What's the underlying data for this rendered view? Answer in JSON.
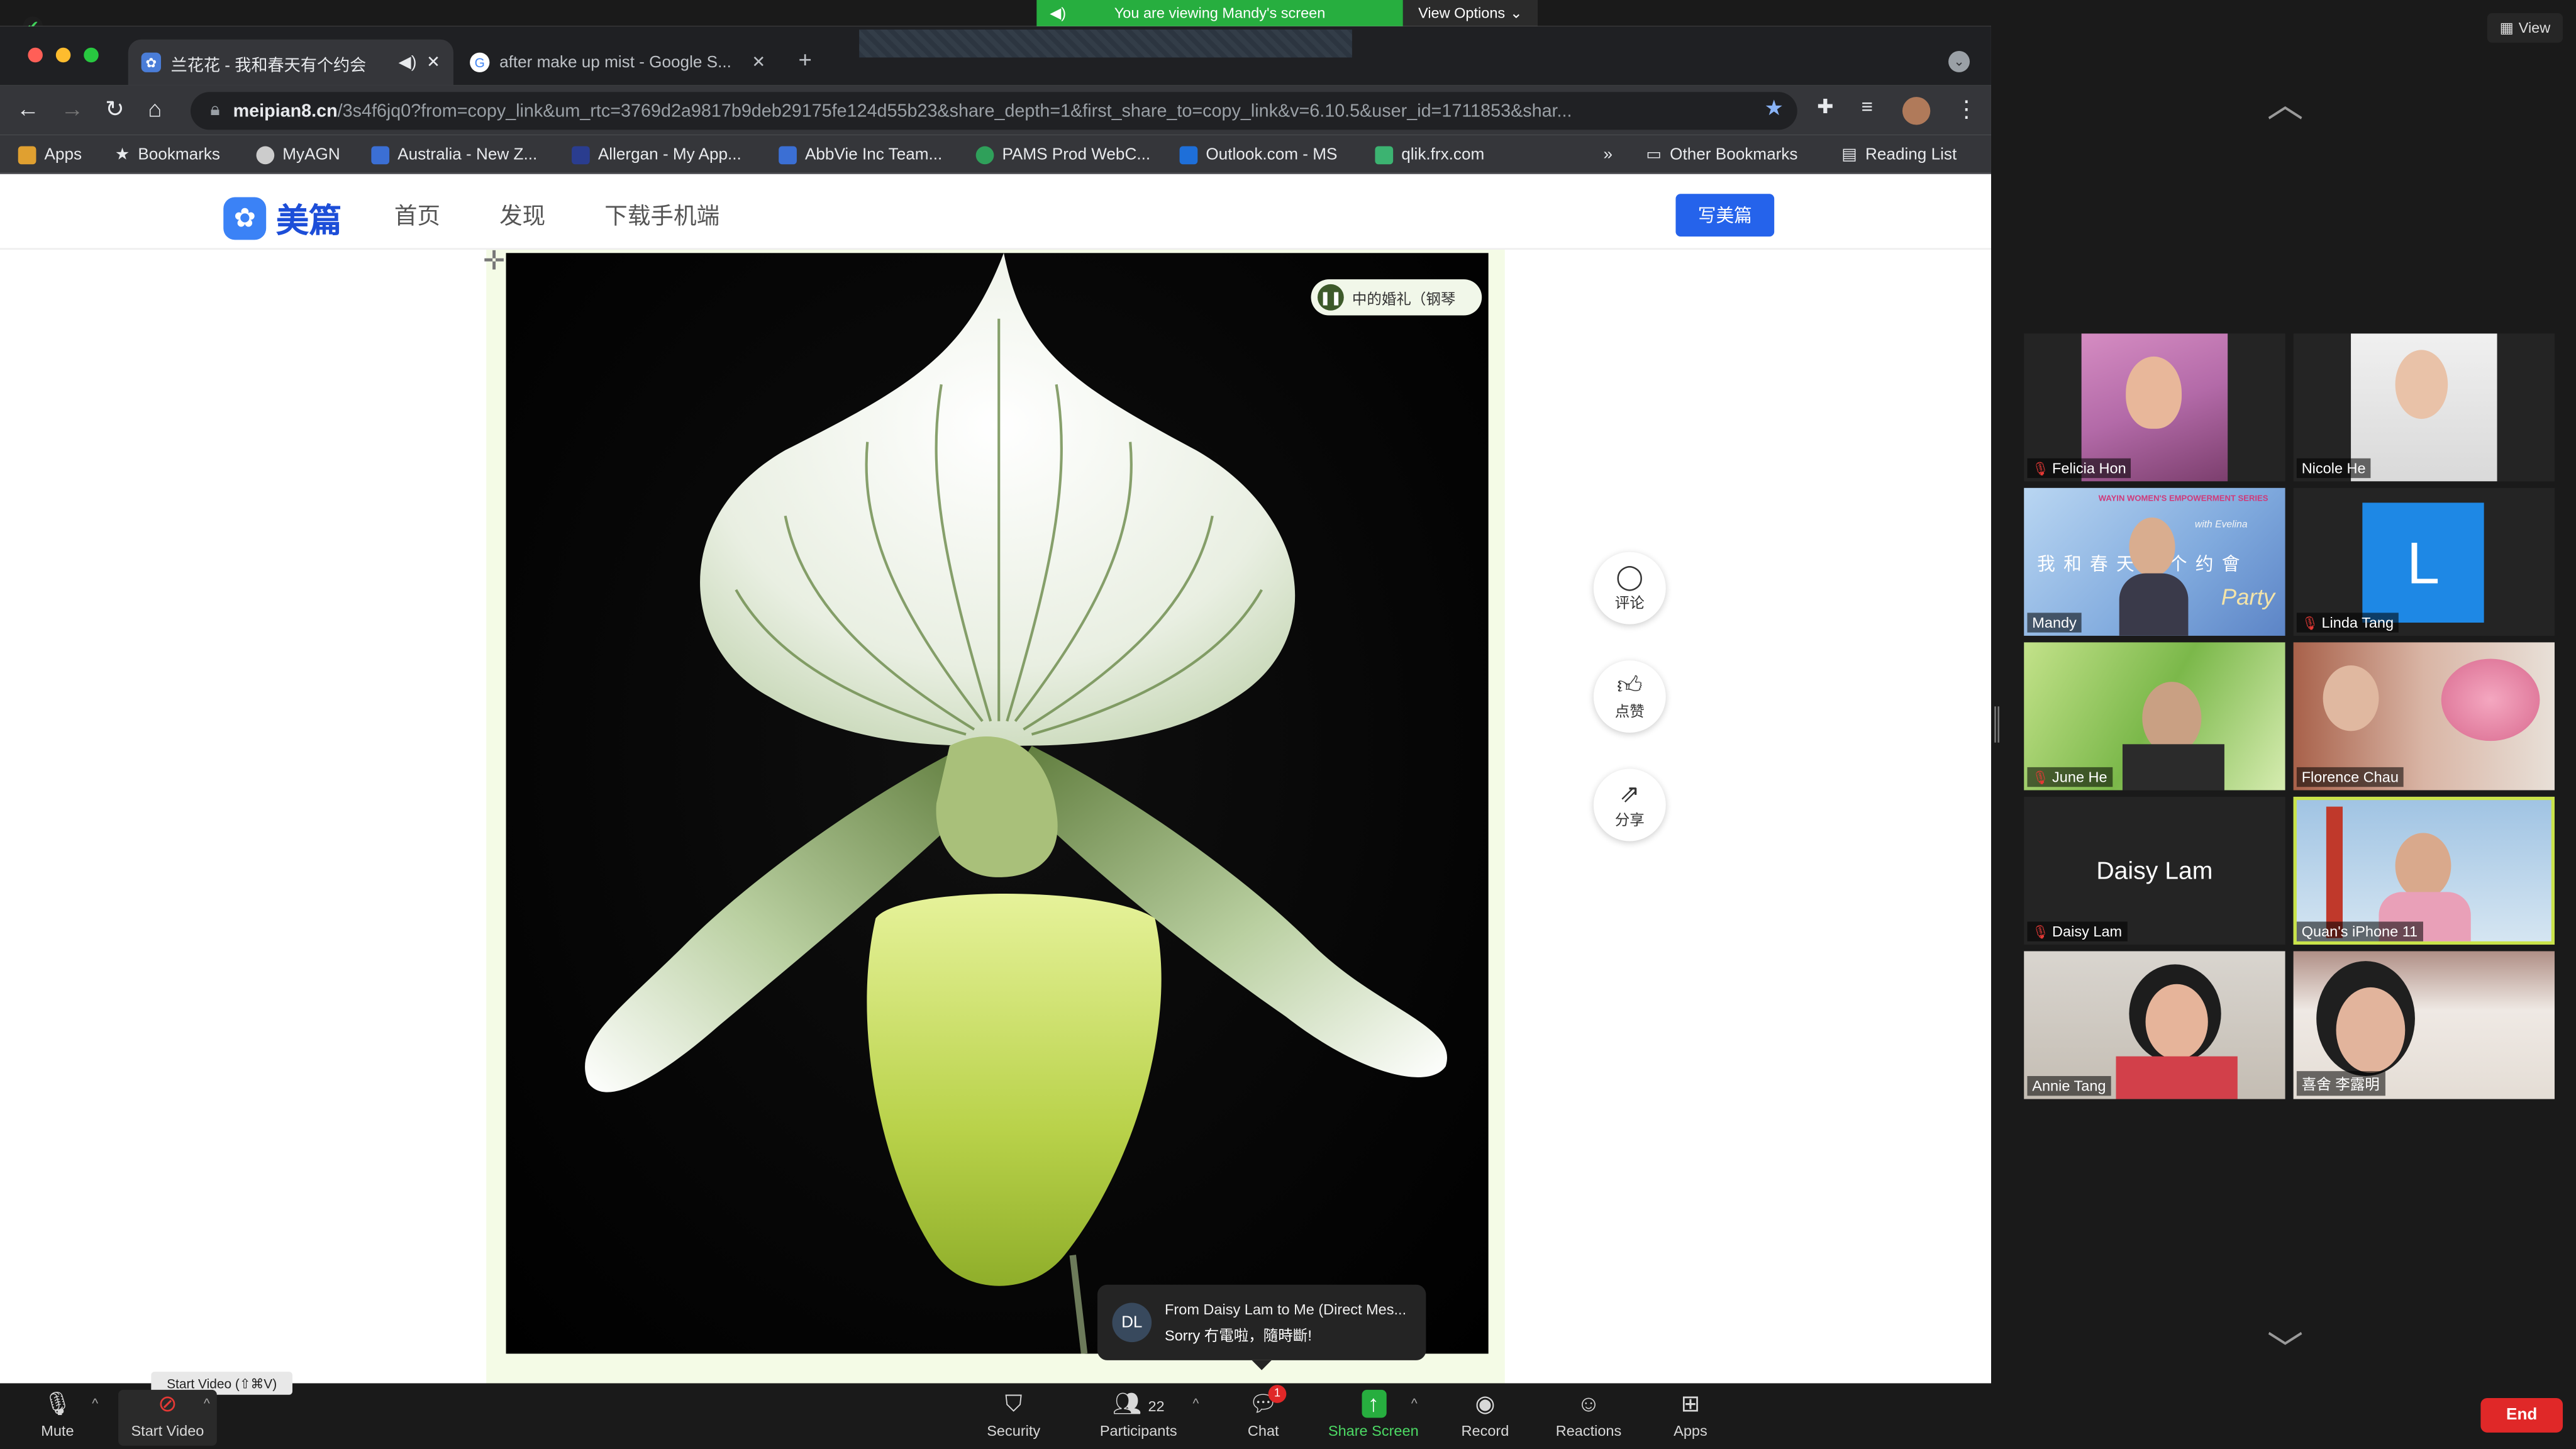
{
  "zoom": {
    "banner_text": "You are viewing Mandy's screen",
    "view_options_label": "View Options",
    "view_button_label": "View",
    "tooltip": "Start Video (⇧⌘V)",
    "end_label": "End",
    "chat_badge": "1",
    "participants_count": "22",
    "controls": [
      {
        "label": "Mute"
      },
      {
        "label": "Start Video"
      },
      {
        "label": "Security"
      },
      {
        "label": "Participants"
      },
      {
        "label": "Chat"
      },
      {
        "label": "Share Screen"
      },
      {
        "label": "Record"
      },
      {
        "label": "Reactions"
      },
      {
        "label": "Apps"
      }
    ],
    "chat_notification": {
      "avatar": "DL",
      "from": "From Daisy Lam to Me (Direct Mes...",
      "message": "Sorry 冇電啦，隨時斷!"
    },
    "gallery": [
      {
        "name": "Felicia Hon"
      },
      {
        "name": "Nicole He"
      },
      {
        "name": "Mandy",
        "banner_title": "WAYIN WOMEN'S EMPOWERMENT SERIES",
        "banner_script": "with Evelina",
        "banner_cn": "我 和 春 天 有 个 约 會",
        "banner_party": "Party"
      },
      {
        "name": "Linda Tang",
        "initial": "L"
      },
      {
        "name": "June He"
      },
      {
        "name": "Florence Chau"
      },
      {
        "name": "Daisy Lam",
        "display": "Daisy Lam"
      },
      {
        "name": "Quan's iPhone  11"
      },
      {
        "name": "Annie Tang"
      },
      {
        "name": "喜舍 李露明"
      }
    ]
  },
  "browser": {
    "tabs": [
      {
        "title": "兰花花 - 我和春天有个约会"
      },
      {
        "title": "after make up mist - Google S..."
      }
    ],
    "url_domain": "meipian8.cn",
    "url_path": "/3s4f6jq0?from=copy_link&um_rtc=3769d2a9817b9deb29175fe124d55b23&share_depth=1&first_share_to=copy_link&v=6.10.5&user_id=1711853&shar...",
    "bookmarks": [
      {
        "label": "Apps",
        "color": "#e0a030"
      },
      {
        "label": "Bookmarks",
        "color": "#dddddd"
      },
      {
        "label": "MyAGN",
        "color": "#cccccc"
      },
      {
        "label": "Australia - New Z...",
        "color": "#3b6fd4"
      },
      {
        "label": "Allergan - My App...",
        "color": "#2a3d8f"
      },
      {
        "label": "AbbVie Inc Team...",
        "color": "#3b6fd4"
      },
      {
        "label": "PAMS Prod WebC...",
        "color": "#2fa05a"
      },
      {
        "label": "Outlook.com - MS",
        "color": "#1e6fd9"
      },
      {
        "label": "qlik.frx.com",
        "color": "#3cb371"
      }
    ],
    "overflow": "»",
    "other_bookmarks": "Other Bookmarks",
    "reading_list": "Reading List"
  },
  "site": {
    "logo_text": "美篇",
    "nav": [
      "首页",
      "发现",
      "下载手机端"
    ],
    "write_button": "写美篇",
    "music_title": "中的婚礼（钢琴",
    "side_buttons": [
      {
        "label": "评论"
      },
      {
        "label": "点赞"
      },
      {
        "label": "分享"
      }
    ]
  },
  "colors": {
    "zoom_green": "#27ae3f",
    "end_red": "#e02828",
    "site_blue": "#2563eb",
    "active_speaker": "#c9e34a"
  }
}
